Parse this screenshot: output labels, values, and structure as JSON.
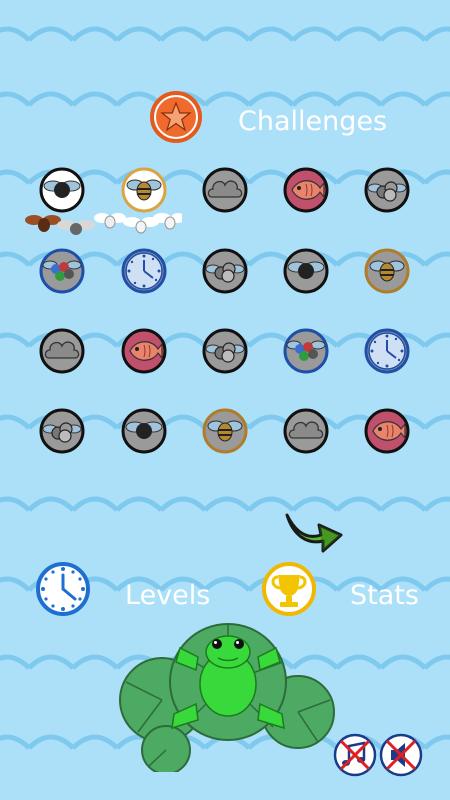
{
  "header": {
    "title": "Challenges",
    "badge_icon": "star-icon"
  },
  "challenges": [
    {
      "icon": "fly",
      "ring": "#111111",
      "bg": "#ffffff"
    },
    {
      "icon": "bee",
      "ring": "#d9a441",
      "bg": "#ffffff"
    },
    {
      "icon": "cloud",
      "ring": "#111111",
      "bg": "#9a9a9a"
    },
    {
      "icon": "fish",
      "ring": "#111111",
      "bg": "#c0506b"
    },
    {
      "icon": "flies",
      "ring": "#111111",
      "bg": "#9a9a9a"
    },
    {
      "icon": "swarm",
      "ring": "#1f4fa8",
      "bg": "#9a9a9a"
    },
    {
      "icon": "clock",
      "ring": "#1f4fa8",
      "bg": "#9a9a9a"
    },
    {
      "icon": "flies",
      "ring": "#111111",
      "bg": "#9a9a9a"
    },
    {
      "icon": "fly",
      "ring": "#111111",
      "bg": "#9a9a9a"
    },
    {
      "icon": "bee",
      "ring": "#b07c2a",
      "bg": "#9a9a9a"
    },
    {
      "icon": "cloud",
      "ring": "#111111",
      "bg": "#9a9a9a"
    },
    {
      "icon": "fish",
      "ring": "#111111",
      "bg": "#c0506b"
    },
    {
      "icon": "flies",
      "ring": "#111111",
      "bg": "#9a9a9a"
    },
    {
      "icon": "swarm",
      "ring": "#1f4fa8",
      "bg": "#9a9a9a"
    },
    {
      "icon": "clock",
      "ring": "#1f4fa8",
      "bg": "#9a9a9a"
    },
    {
      "icon": "flies",
      "ring": "#111111",
      "bg": "#9a9a9a"
    },
    {
      "icon": "fly",
      "ring": "#111111",
      "bg": "#9a9a9a"
    },
    {
      "icon": "bee",
      "ring": "#b07c2a",
      "bg": "#9a9a9a"
    },
    {
      "icon": "cloud",
      "ring": "#111111",
      "bg": "#9a9a9a"
    },
    {
      "icon": "fish",
      "ring": "#111111",
      "bg": "#c0506b"
    }
  ],
  "navigation": {
    "next_icon": "arrow-right-icon"
  },
  "bottom": {
    "levels_label": "Levels",
    "levels_icon": "clock-icon",
    "stats_label": "Stats",
    "stats_icon": "trophy-icon"
  },
  "audio": {
    "music_icon": "music-off-icon",
    "sound_icon": "sound-off-icon"
  },
  "colors": {
    "background": "#ace0f9",
    "wave": "#7fc9ee",
    "text": "#ffffff"
  }
}
